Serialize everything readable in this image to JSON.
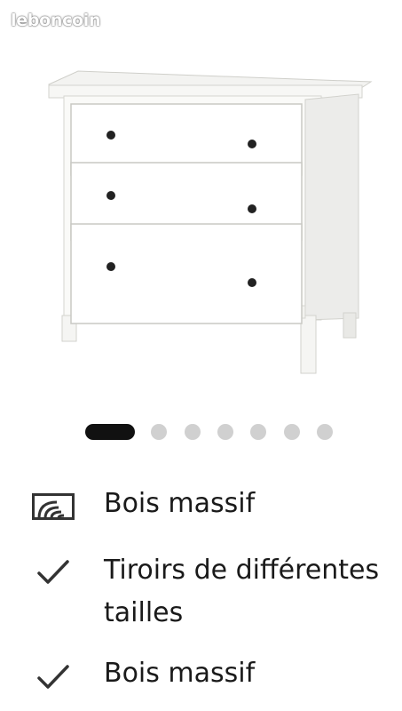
{
  "listing": {
    "watermark": "leboncoin",
    "photo": {
      "subject": "white three-drawer chest",
      "colors": {
        "body": "#ffffff",
        "panel_shade": "#eeeeea",
        "edge": "#c9c9c4",
        "knob": "#222222"
      }
    },
    "carousel": {
      "dot_count": 7,
      "active_index": 0,
      "colors": {
        "active": "#111111",
        "inactive": "#d0d0d0"
      }
    },
    "features": [
      {
        "icon": "wood-grain-icon",
        "label": "Bois massif"
      },
      {
        "icon": "checkmark-icon",
        "label": "Tiroirs de différentes tailles"
      },
      {
        "icon": "checkmark-icon",
        "label": "Bois massif"
      }
    ]
  }
}
